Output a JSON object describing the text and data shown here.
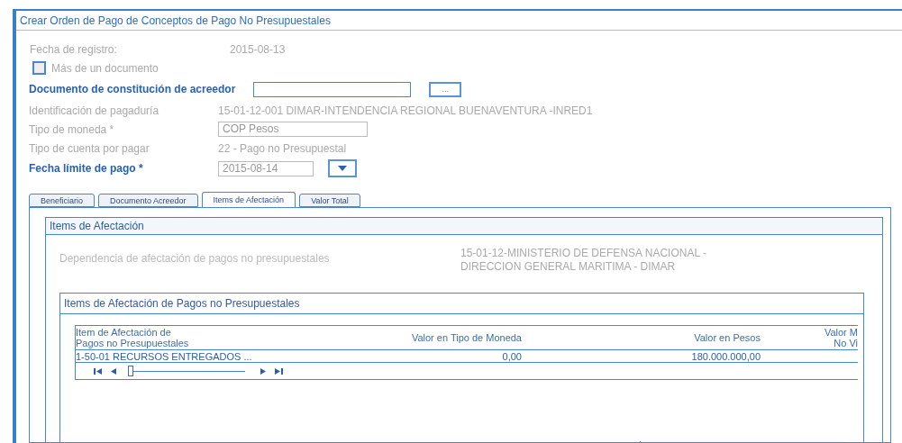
{
  "window": {
    "title": "Crear Orden de Pago de Conceptos de Pago No Presupuestales"
  },
  "form": {
    "registro": {
      "label": "Fecha de registro:",
      "value": "2015-08-13"
    },
    "mas_documento": {
      "label": "Más de un documento",
      "checked": false
    },
    "fields": [
      {
        "kind": "lookup",
        "label": "Documento de constitución de acreedor",
        "button": "...",
        "required_style": true
      },
      {
        "kind": "text",
        "label": "Identificación de pagaduría",
        "value": "15-01-12-001 DIMAR-INTENDENCIA REGIONAL BUENAVENTURA -INRED1",
        "required_style": false
      },
      {
        "kind": "input",
        "label": "Tipo de moneda *",
        "value": "COP Pesos",
        "required_style": false
      },
      {
        "kind": "text",
        "label": "Tipo de cuenta por pagar",
        "value": "22 - Pago no Presupuestal",
        "required_style": false
      },
      {
        "kind": "date",
        "label": "Fecha límite de pago *",
        "value": "2015-08-14",
        "required_style": true
      }
    ]
  },
  "tabs": [
    {
      "label": "Beneficiario",
      "selected": false
    },
    {
      "label": "Documento Acreedor",
      "selected": false
    },
    {
      "label": "Items de Afectación",
      "selected": true
    },
    {
      "label": "Valor Total",
      "selected": false
    }
  ],
  "section": {
    "title": "Items de Afectación",
    "dependencia_label": "Dependencia de afectación de pagos no presupuestales",
    "dependencia_value": "15-01-12-MINISTERIO DE DEFENSA NACIONAL -\nDIRECCION GENERAL MARITIMA - DIMAR",
    "table_panel": {
      "title": "Items de Afectación de Pagos no Presupuestales",
      "columns": [
        "Item de Afectación de\nPagos no Presupuestales",
        "Valor en Tipo de Moneda",
        "Valor en Pesos",
        "Valor M\nNo Vi"
      ],
      "rows": [
        [
          "1-50-01 RECURSOS ENTREGADOS ...",
          "0,00",
          "180.000.000,00",
          ""
        ]
      ],
      "pager": {
        "level": 0
      }
    }
  }
}
